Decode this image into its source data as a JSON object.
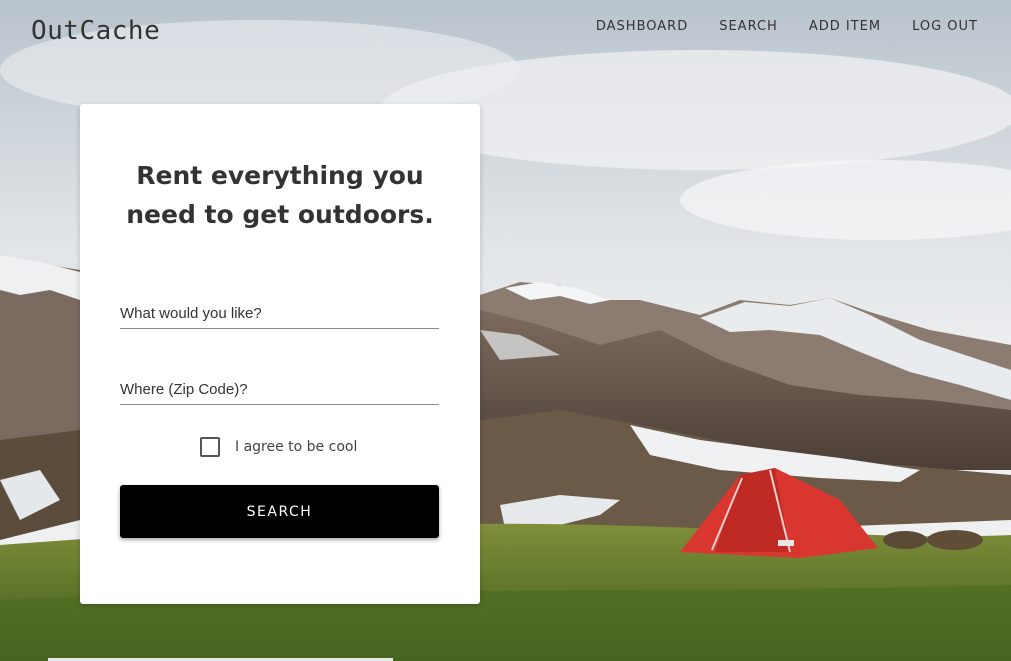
{
  "header": {
    "logo": "OutCache",
    "nav": [
      {
        "label": "DASHBOARD"
      },
      {
        "label": "SEARCH"
      },
      {
        "label": "ADD ITEM"
      },
      {
        "label": "LOG OUT"
      }
    ]
  },
  "card": {
    "headline_line1": "Rent everything you",
    "headline_line2": "need to get outdoors.",
    "item_field": {
      "placeholder": "What would you like?",
      "value": ""
    },
    "zip_field": {
      "placeholder": "Where (Zip Code)?",
      "value": ""
    },
    "agree_label": "I agree to be cool",
    "agree_checked": false,
    "search_label": "SEARCH"
  },
  "colors": {
    "button_bg": "#000000",
    "tent": "#d8362f",
    "grass": "#5d7a2a"
  }
}
